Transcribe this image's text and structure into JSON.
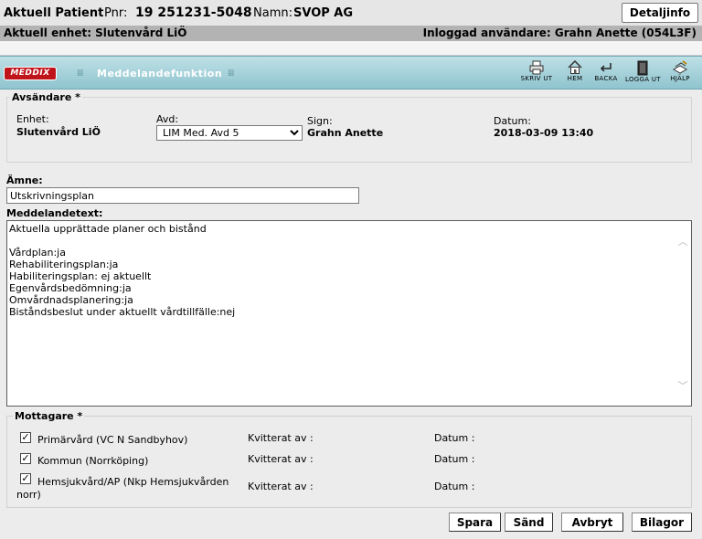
{
  "patient": {
    "current_patient_label": "Aktuell Patient",
    "pnr_label": "Pnr:",
    "pnr_value": "19 251231-5048",
    "name_label": "Namn:",
    "name_value": "SVOP AG",
    "details_button": "Detaljinfo"
  },
  "unit_bar": {
    "current_unit": "Aktuell enhet: Slutenvård LiÖ",
    "logged_in_user": "Inloggad användare: Grahn Anette (054L3F)"
  },
  "toolbar": {
    "logo_text": "MEDDIX",
    "module_title": "Meddelandefunktion",
    "tools": [
      {
        "label": "SKRIV UT",
        "icon": "printer-icon"
      },
      {
        "label": "HEM",
        "icon": "home-icon"
      },
      {
        "label": "BACKA",
        "icon": "back-arrow-icon"
      },
      {
        "label": "LOGGA UT",
        "icon": "door-icon"
      },
      {
        "label": "HJÄLP",
        "icon": "help-book-icon"
      }
    ]
  },
  "sender": {
    "title": "Avsändare *",
    "unit_label": "Enhet:",
    "unit_value": "Slutenvård LiÖ",
    "avd_label": "Avd:",
    "avd_selected": "LIM Med. Avd 5",
    "sign_label": "Sign:",
    "sign_value": "Grahn Anette",
    "date_label": "Datum:",
    "date_value": "2018-03-09 13:40"
  },
  "subject": {
    "label": "Ämne:",
    "value": "Utskrivningsplan"
  },
  "message": {
    "label": "Meddelandetext:",
    "lines": [
      "Aktuella upprättade planer och bistånd",
      "",
      "Vårdplan:ja",
      "Rehabiliteringsplan:ja",
      "Habiliteringsplan: ej aktuellt",
      "Egenvårdsbedömning:ja",
      "Omvårdnadsplanering:ja",
      "Biståndsbeslut under aktuellt vårdtillfälle:nej"
    ]
  },
  "recipients": {
    "title": "Mottagare *",
    "acknowledged_label": "Kvitterat av :",
    "date_label": "Datum :",
    "items": [
      {
        "name": "Primärvård (VC N Sandbyhov)",
        "checked": true
      },
      {
        "name": "Kommun (Norrköping)",
        "checked": true
      },
      {
        "name_line1": "Hemsjukvård/AP (Nkp Hemsjukvården",
        "name_line2": "norr)",
        "checked": true
      }
    ]
  },
  "actions": {
    "save": "Spara",
    "send": "Sänd",
    "cancel": "Avbryt",
    "attachments": "Bilagor"
  }
}
